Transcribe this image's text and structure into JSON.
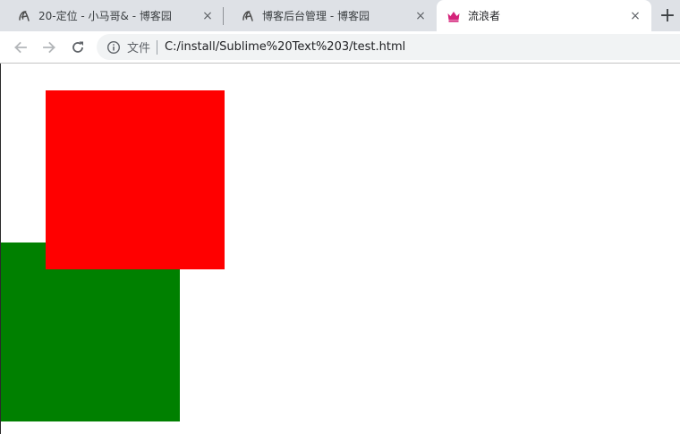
{
  "tabs": [
    {
      "title": "20-定位 - 小马哥& - 博客园",
      "favicon": "cnblogs-icon",
      "active": false
    },
    {
      "title": "博客后台管理 - 博客园",
      "favicon": "cnblogs-icon",
      "active": false
    },
    {
      "title": "流浪者",
      "favicon": "crown-icon",
      "active": true
    }
  ],
  "tab_close_glyph": "×",
  "new_tab_glyph": "+",
  "omnibox": {
    "scheme_label": "文件",
    "url": "C:/install/Sublime%20Text%203/test.html"
  },
  "page": {
    "boxes": [
      {
        "name": "green-box",
        "color": "#008000"
      },
      {
        "name": "red-box",
        "color": "#ff0000"
      }
    ]
  },
  "colors": {
    "tabstrip_bg": "#dee1e6",
    "omnibox_bg": "#f1f3f4",
    "crown_favicon": "#d4237a"
  }
}
